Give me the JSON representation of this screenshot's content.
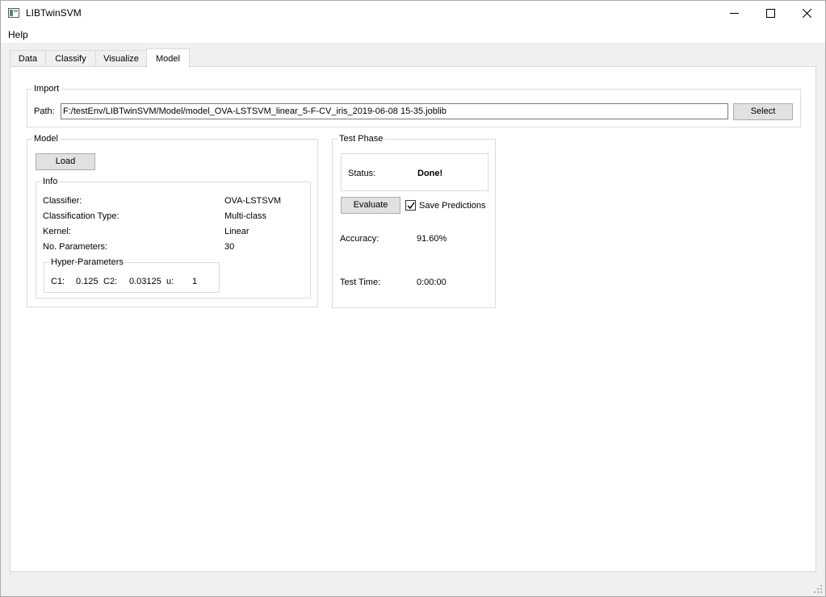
{
  "window": {
    "title": "LIBTwinSVM",
    "controls": {
      "minimize_icon": "minimize-icon",
      "maximize_icon": "maximize-icon",
      "close_icon": "close-icon"
    }
  },
  "menu": {
    "items": [
      {
        "label": "Help"
      }
    ]
  },
  "tabs": [
    {
      "label": "Data",
      "active": false
    },
    {
      "label": "Classify",
      "active": false
    },
    {
      "label": "Visualize",
      "active": false
    },
    {
      "label": "Model",
      "active": true
    }
  ],
  "import": {
    "title": "Import",
    "path_label": "Path:",
    "path_value": "F:/testEnv/LIBTwinSVM/Model/model_OVA-LSTSVM_linear_5-F-CV_iris_2019-06-08 15-35.joblib",
    "select_label": "Select"
  },
  "model": {
    "title": "Model",
    "load_label": "Load",
    "info": {
      "title": "Info",
      "rows": [
        {
          "label": "Classifier:",
          "value": "OVA-LSTSVM"
        },
        {
          "label": "Classification Type:",
          "value": "Multi-class"
        },
        {
          "label": "Kernel:",
          "value": "Linear"
        },
        {
          "label": "No. Parameters:",
          "value": "30"
        }
      ],
      "hyper": {
        "title": "Hyper-Parameters",
        "c1_label": "C1:",
        "c1_value": "0.125",
        "c2_label": "C2:",
        "c2_value": "0.03125",
        "u_label": "u:",
        "u_value": "1"
      }
    }
  },
  "test_phase": {
    "title": "Test Phase",
    "status_label": "Status:",
    "status_value": "Done!",
    "evaluate_label": "Evaluate",
    "save_predictions_label": "Save Predictions",
    "save_predictions_checked": true,
    "accuracy_label": "Accuracy:",
    "accuracy_value": "91.60%",
    "test_time_label": "Test Time:",
    "test_time_value": "0:00:00"
  }
}
